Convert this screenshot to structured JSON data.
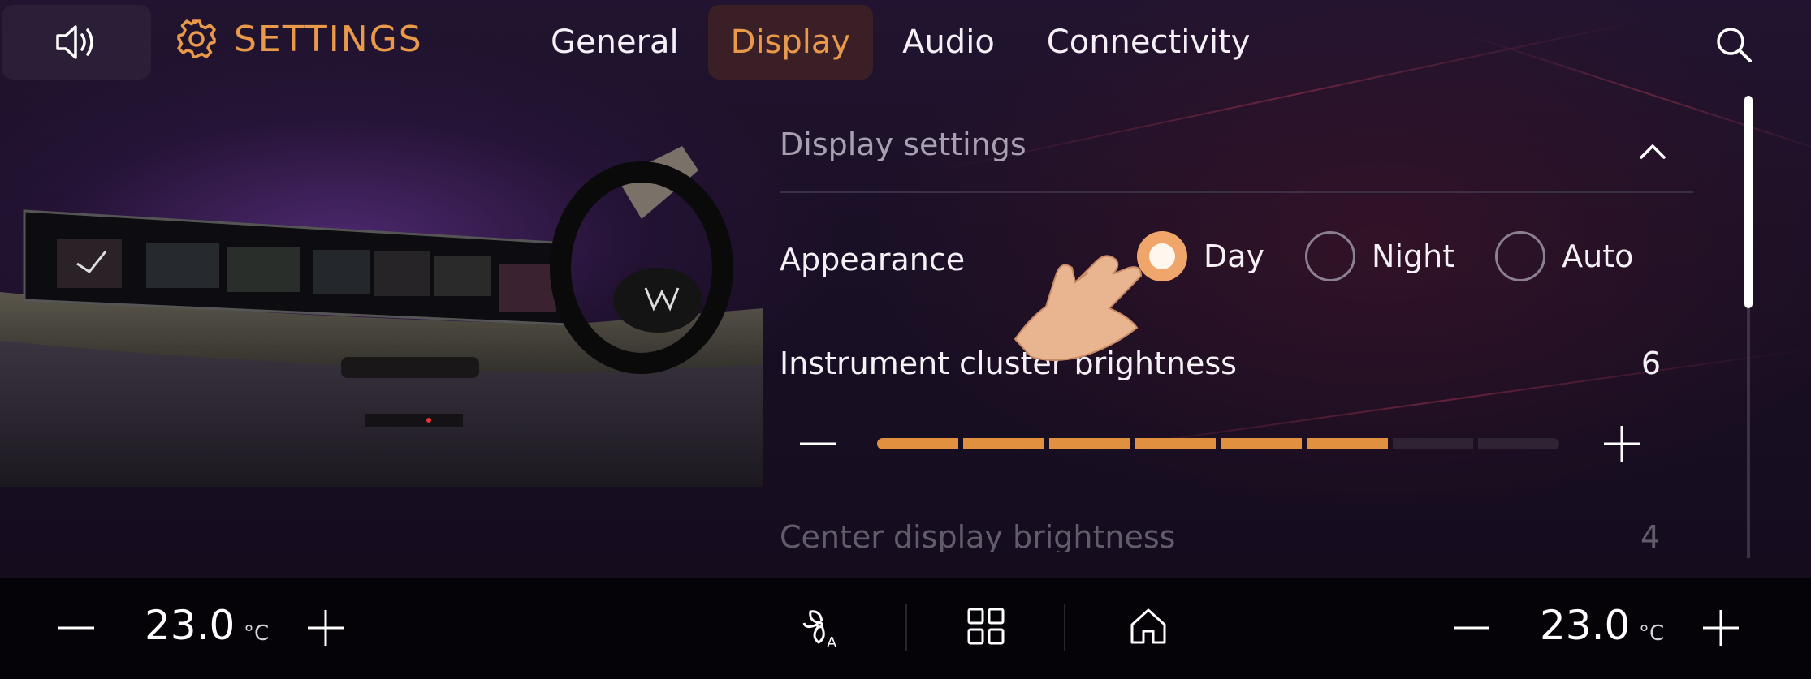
{
  "header": {
    "title": "SETTINGS",
    "tabs": [
      {
        "label": "General",
        "active": false
      },
      {
        "label": "Display",
        "active": true
      },
      {
        "label": "Audio",
        "active": false
      },
      {
        "label": "Connectivity",
        "active": false
      }
    ]
  },
  "panel": {
    "section_title": "Display settings",
    "appearance": {
      "label": "Appearance",
      "options": [
        {
          "label": "Day",
          "selected": true
        },
        {
          "label": "Night",
          "selected": false
        },
        {
          "label": "Auto",
          "selected": false
        }
      ]
    },
    "cluster_brightness": {
      "label": "Instrument cluster brightness",
      "value": "6",
      "level": 6,
      "max": 8
    },
    "center_brightness": {
      "label": "Center display brightness",
      "value": "4"
    }
  },
  "climate": {
    "left_temp": "23.0",
    "right_temp": "23.0",
    "unit": "°C"
  },
  "colors": {
    "accent": "#e8994a",
    "slider_on": "#e0903e",
    "slider_off": "#2e2434"
  }
}
